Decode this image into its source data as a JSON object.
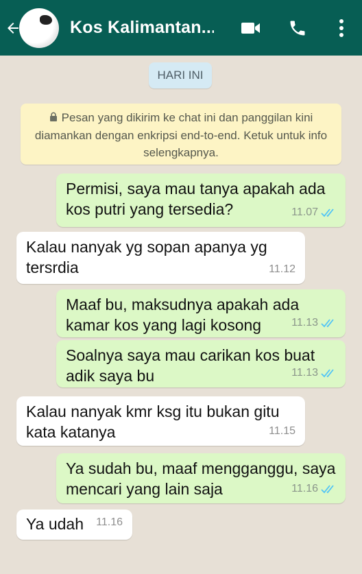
{
  "header": {
    "title": "Kos Kalimantan...",
    "color": "#075e54",
    "icons": [
      "back-arrow-icon",
      "video-call-icon",
      "phone-icon",
      "more-options-icon"
    ]
  },
  "chat": {
    "date_label": "HARI INI",
    "encryption_notice": "Pesan yang dikirim ke chat ini dan panggilan kini diamankan dengan enkripsi end-to-end. Ketuk untuk info selengkapnya.",
    "messages": [
      {
        "direction": "outgoing",
        "text": "Permisi, saya mau tanya apakah ada kos putri yang tersedia?",
        "time": "11.07",
        "status": "read"
      },
      {
        "direction": "incoming",
        "text": "Kalau nanyak yg sopan apanya yg tersrdia",
        "time": "11.12"
      },
      {
        "direction": "outgoing",
        "text": "Maaf bu, maksudnya apakah ada kamar kos yang lagi kosong",
        "time": "11.13",
        "status": "read"
      },
      {
        "direction": "outgoing",
        "text": "Soalnya saya mau carikan kos buat adik saya bu",
        "time": "11.13",
        "status": "read"
      },
      {
        "direction": "incoming",
        "text": "Kalau nanyak kmr ksg itu bukan gitu kata  katanya",
        "time": "11.15"
      },
      {
        "direction": "outgoing",
        "text": "Ya sudah bu, maaf mengganggu, saya mencari yang lain saja",
        "time": "11.16",
        "status": "read"
      },
      {
        "direction": "incoming",
        "text": "Ya udah",
        "time": "11.16"
      }
    ]
  },
  "colors": {
    "outgoing_bubble": "#dcf8c6",
    "incoming_bubble": "#ffffff",
    "chat_background": "#e7e0d6",
    "read_ticks": "#4fc3f7"
  }
}
